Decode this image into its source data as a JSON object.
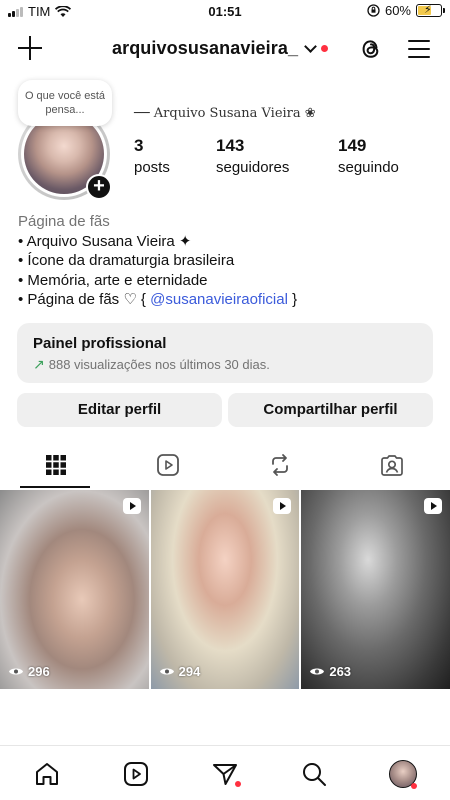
{
  "status_bar": {
    "carrier": "TIM",
    "time": "01:51",
    "battery": "60%",
    "battery_level": 0.6
  },
  "header": {
    "username": "arquivosusanavieira_",
    "icons": [
      "plus-icon",
      "chevron-down-icon",
      "threads-icon",
      "menu-icon"
    ]
  },
  "profile": {
    "note": "O que você está pensa...",
    "display_name": "── Arquivo Susana Vieira ❀",
    "stats": {
      "posts": {
        "value": "3",
        "label": "posts"
      },
      "followers": {
        "value": "143",
        "label": "seguidores"
      },
      "following": {
        "value": "149",
        "label": "seguindo"
      }
    }
  },
  "bio": {
    "category": "Página de fãs",
    "line1": "• Arquivo Susana Vieira ✦",
    "line2": "• Ícone da dramaturgia brasileira",
    "line3": "• Memória, arte e eternidade",
    "line4_prefix": "• Página de fãs ♡ { ",
    "line4_mention": "@susanavieiraoficial",
    "line4_suffix": " }"
  },
  "dashboard": {
    "title": "Painel profissional",
    "subtitle": "888 visualizações nos últimos 30 dias."
  },
  "buttons": {
    "edit": "Editar perfil",
    "share": "Compartilhar perfil"
  },
  "tabs": [
    "grid-icon",
    "reels-icon",
    "reposts-icon",
    "tagged-icon"
  ],
  "posts": [
    {
      "views": "296"
    },
    {
      "views": "294"
    },
    {
      "views": "263"
    }
  ],
  "bottom_nav": [
    "home-icon",
    "reels-icon",
    "send-icon",
    "search-icon",
    "profile-avatar"
  ],
  "colors": {
    "accent_red": "#ff3040",
    "mention_blue": "#3b5bdb",
    "panel_gray": "#efefef"
  }
}
